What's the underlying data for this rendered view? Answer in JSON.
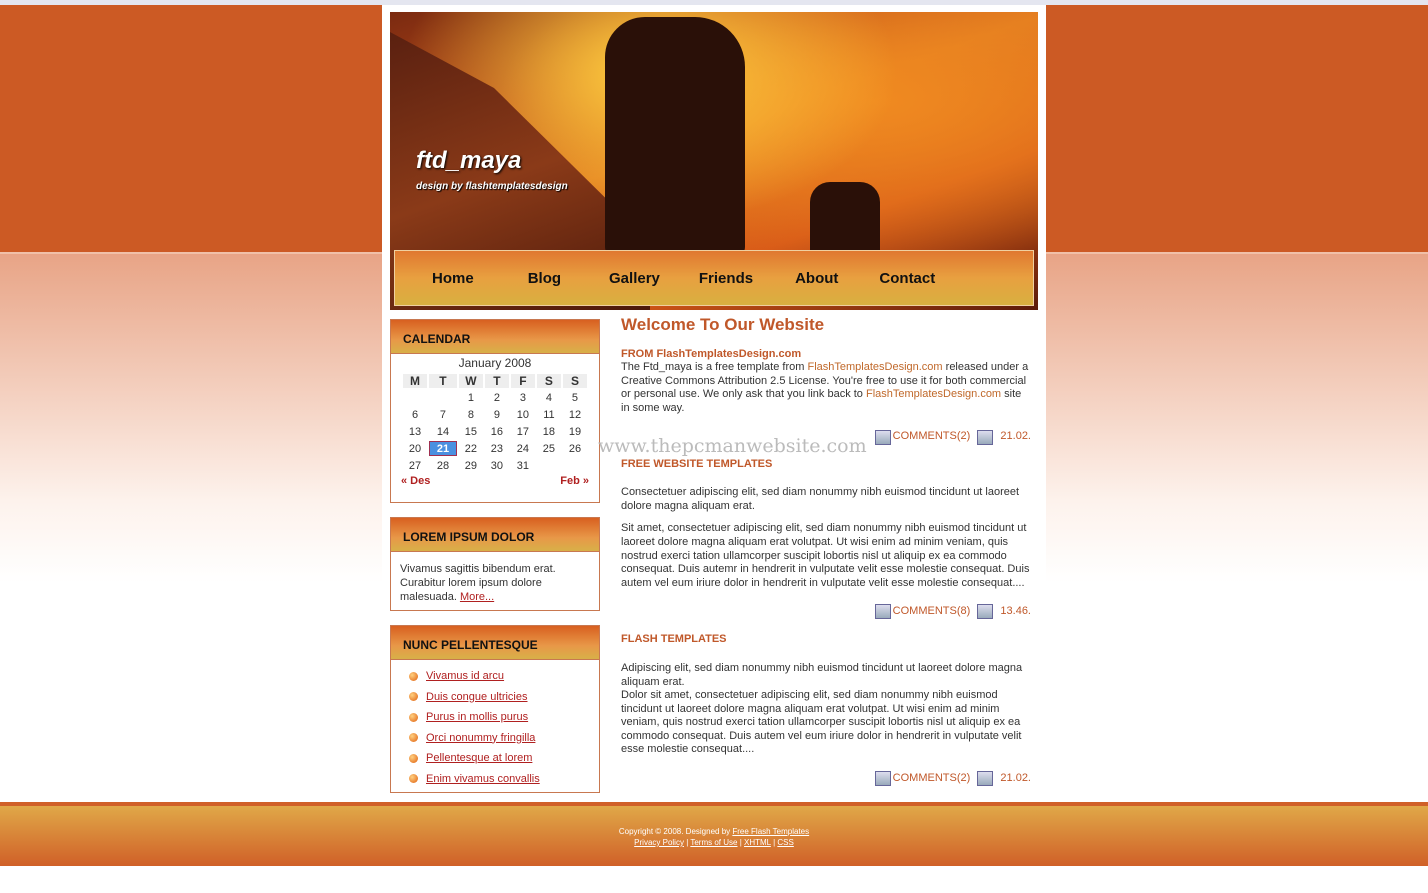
{
  "header": {
    "title": "ftd_maya",
    "tagline": "design by flashtemplatesdesign"
  },
  "nav": [
    "Home",
    "Blog",
    "Gallery",
    "Friends",
    "About",
    "Contact"
  ],
  "calendar": {
    "title": "CALENDAR",
    "month": "January 2008",
    "days": [
      "M",
      "T",
      "W",
      "T",
      "F",
      "S",
      "S"
    ],
    "weeks": [
      [
        "",
        "",
        "1",
        "2",
        "3",
        "4",
        "5"
      ],
      [
        "6",
        "7",
        "8",
        "9",
        "10",
        "11",
        "12"
      ],
      [
        "13",
        "14",
        "15",
        "16",
        "17",
        "18",
        "19"
      ],
      [
        "20",
        "21",
        "22",
        "23",
        "24",
        "25",
        "26"
      ],
      [
        "27",
        "28",
        "29",
        "30",
        "31",
        "",
        ""
      ]
    ],
    "today": "21",
    "prev": "« Des",
    "next": "Feb »"
  },
  "lorem": {
    "title": "LOREM IPSUM DOLOR",
    "text": "Vivamus sagittis bibendum erat. Curabitur lorem ipsum dolore malesuada.",
    "more": "More..."
  },
  "nunc": {
    "title": "NUNC PELLENTESQUE",
    "items": [
      "Vivamus id arcu",
      "Duis congue ultricies",
      "Purus in mollis purus",
      "Orci nonummy fringilla",
      "Pellentesque at lorem",
      "Enim vivamus convallis"
    ]
  },
  "main": {
    "title": "Welcome To Our Website",
    "posts": [
      {
        "subtitle": "FROM FlashTemplatesDesign.com",
        "p1a": "The Ftd_maya is a free template from ",
        "link1": "FlashTemplatesDesign.com",
        "p1b": " released under a Creative Commons Attribution 2.5 License. You're free to use it for both commercial or personal use. We only ask that you link back to ",
        "link2": "FlashTemplatesDesign.com",
        "p1c": " site in some way.",
        "comments": "COMMENTS(2)",
        "date": "21.02."
      },
      {
        "subtitle": "FREE WEBSITE TEMPLATES",
        "p1": "Consectetuer adipiscing elit, sed diam nonummy nibh euismod tincidunt ut laoreet dolore magna aliquam erat.",
        "p2": "Sit amet, consectetuer adipiscing elit, sed diam nonummy nibh euismod tincidunt ut laoreet dolore magna aliquam erat volutpat. Ut wisi enim ad minim veniam, quis nostrud exerci tation ullamcorper suscipit lobortis nisl ut aliquip ex ea commodo consequat. Duis autemr in hendrerit in vulputate velit esse molestie consequat. Duis autem vel eum iriure dolor in hendrerit in vulputate velit esse molestie consequat....",
        "comments": "COMMENTS(8)",
        "date": "13.46."
      },
      {
        "subtitle": "FLASH TEMPLATES",
        "p1": "Adipiscing elit, sed diam nonummy nibh euismod tincidunt ut laoreet dolore magna aliquam erat.",
        "p2": "Dolor sit amet, consectetuer adipiscing elit, sed diam nonummy nibh euismod tincidunt ut laoreet dolore magna aliquam erat volutpat. Ut wisi enim ad minim veniam, quis nostrud exerci tation ullamcorper suscipit lobortis nisl ut aliquip ex ea commodo consequat. Duis autem vel eum iriure dolor in hendrerit in vulputate velit esse molestie consequat....",
        "comments": "COMMENTS(2)",
        "date": "21.02."
      }
    ]
  },
  "watermark": "www.thepcmanwebsite.com",
  "footer": {
    "copyright": "Copyright © 2008. Designed by ",
    "designer": "Free Flash Templates",
    "links": [
      "Privacy Policy",
      "Terms of Use",
      "XHTML",
      "CSS"
    ]
  }
}
